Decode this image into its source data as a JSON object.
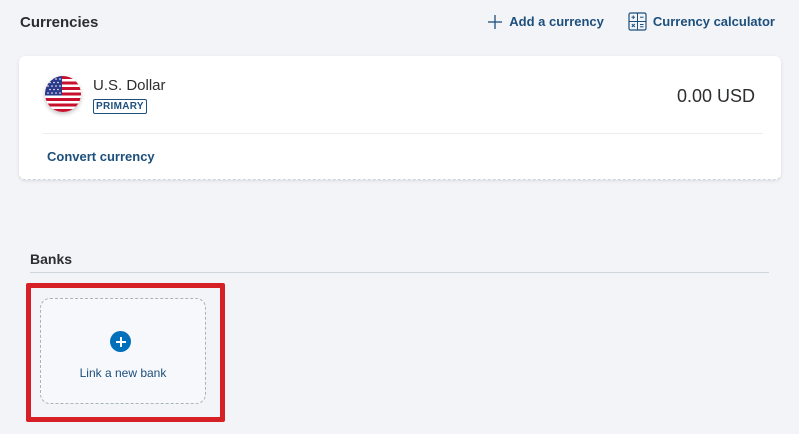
{
  "currencies": {
    "title": "Currencies",
    "add_currency_label": "Add a currency",
    "calculator_label": "Currency calculator"
  },
  "currency_card": {
    "name": "U.S. Dollar",
    "badge": "PRIMARY",
    "balance": "0.00 USD",
    "convert_label": "Convert currency",
    "flag_icon": "us-flag-icon"
  },
  "banks": {
    "title": "Banks",
    "link_bank_label": "Link a new bank",
    "link_icon": "plus-circle-icon",
    "highlight_color": "#d72026"
  },
  "colors": {
    "link": "#1d4f7c",
    "accent": "#0070ba",
    "background": "#f2f4f8"
  }
}
